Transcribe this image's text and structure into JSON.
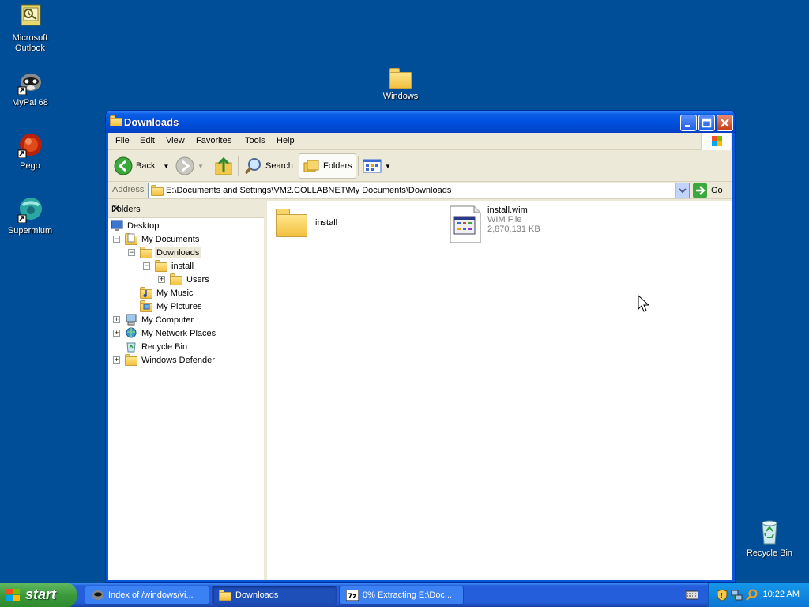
{
  "desktop": {
    "icons": [
      {
        "label_line1": "Microsoft",
        "label_line2": "Outlook",
        "icon": "outlook-icon"
      },
      {
        "label_line1": "MyPal 68",
        "label_line2": "",
        "icon": "mypal-icon"
      },
      {
        "label_line1": "Pego",
        "label_line2": "",
        "icon": "pego-icon"
      },
      {
        "label_line1": "Supermium",
        "label_line2": "",
        "icon": "supermium-icon"
      },
      {
        "label_line1": "Windows",
        "label_line2": "",
        "icon": "folder-icon"
      },
      {
        "label_line1": "Recycle Bin",
        "label_line2": "",
        "icon": "recycle-bin-icon"
      }
    ]
  },
  "window": {
    "title": "Downloads",
    "menu": [
      "File",
      "Edit",
      "View",
      "Favorites",
      "Tools",
      "Help"
    ],
    "toolbar": {
      "back": "Back",
      "search": "Search",
      "folders": "Folders"
    },
    "address": {
      "label": "Address",
      "value": "E:\\Documents and Settings\\VM2.COLLABNET\\My Documents\\Downloads",
      "go": "Go"
    },
    "folders_pane": {
      "title": "Folders",
      "close": "✕",
      "tree": [
        {
          "label": "Desktop",
          "expander": "",
          "icon": "desktop-icon"
        },
        {
          "label": "My Documents",
          "expander": "−",
          "icon": "my-documents-icon"
        },
        {
          "label": "Downloads",
          "expander": "−",
          "icon": "folder-open-icon",
          "selected": true
        },
        {
          "label": "install",
          "expander": "−",
          "icon": "folder-open-icon"
        },
        {
          "label": "Users",
          "expander": "+",
          "icon": "folder-icon"
        },
        {
          "label": "My Music",
          "expander": "",
          "icon": "my-music-icon"
        },
        {
          "label": "My Pictures",
          "expander": "",
          "icon": "my-pictures-icon"
        },
        {
          "label": "My Computer",
          "expander": "+",
          "icon": "my-computer-icon"
        },
        {
          "label": "My Network Places",
          "expander": "+",
          "icon": "network-places-icon"
        },
        {
          "label": "Recycle Bin",
          "expander": "",
          "icon": "recycle-bin-icon"
        },
        {
          "label": "Windows Defender",
          "expander": "+",
          "icon": "folder-icon"
        }
      ]
    },
    "files": [
      {
        "name": "install",
        "type": "",
        "size": "",
        "icon": "folder-icon"
      },
      {
        "name": "install.wim",
        "type": "WIM File",
        "size": "2,870,131 KB",
        "icon": "wim-file-icon"
      }
    ]
  },
  "taskbar": {
    "start": "start",
    "tasks": [
      {
        "label": "Index of /windows/vi...",
        "icon": "mypal-icon",
        "active": false
      },
      {
        "label": "Downloads",
        "icon": "folder-icon",
        "active": true
      },
      {
        "label": "0% Extracting E:\\Doc...",
        "icon": "7zip-icon",
        "active": false
      }
    ],
    "clock": "10:22 AM"
  }
}
